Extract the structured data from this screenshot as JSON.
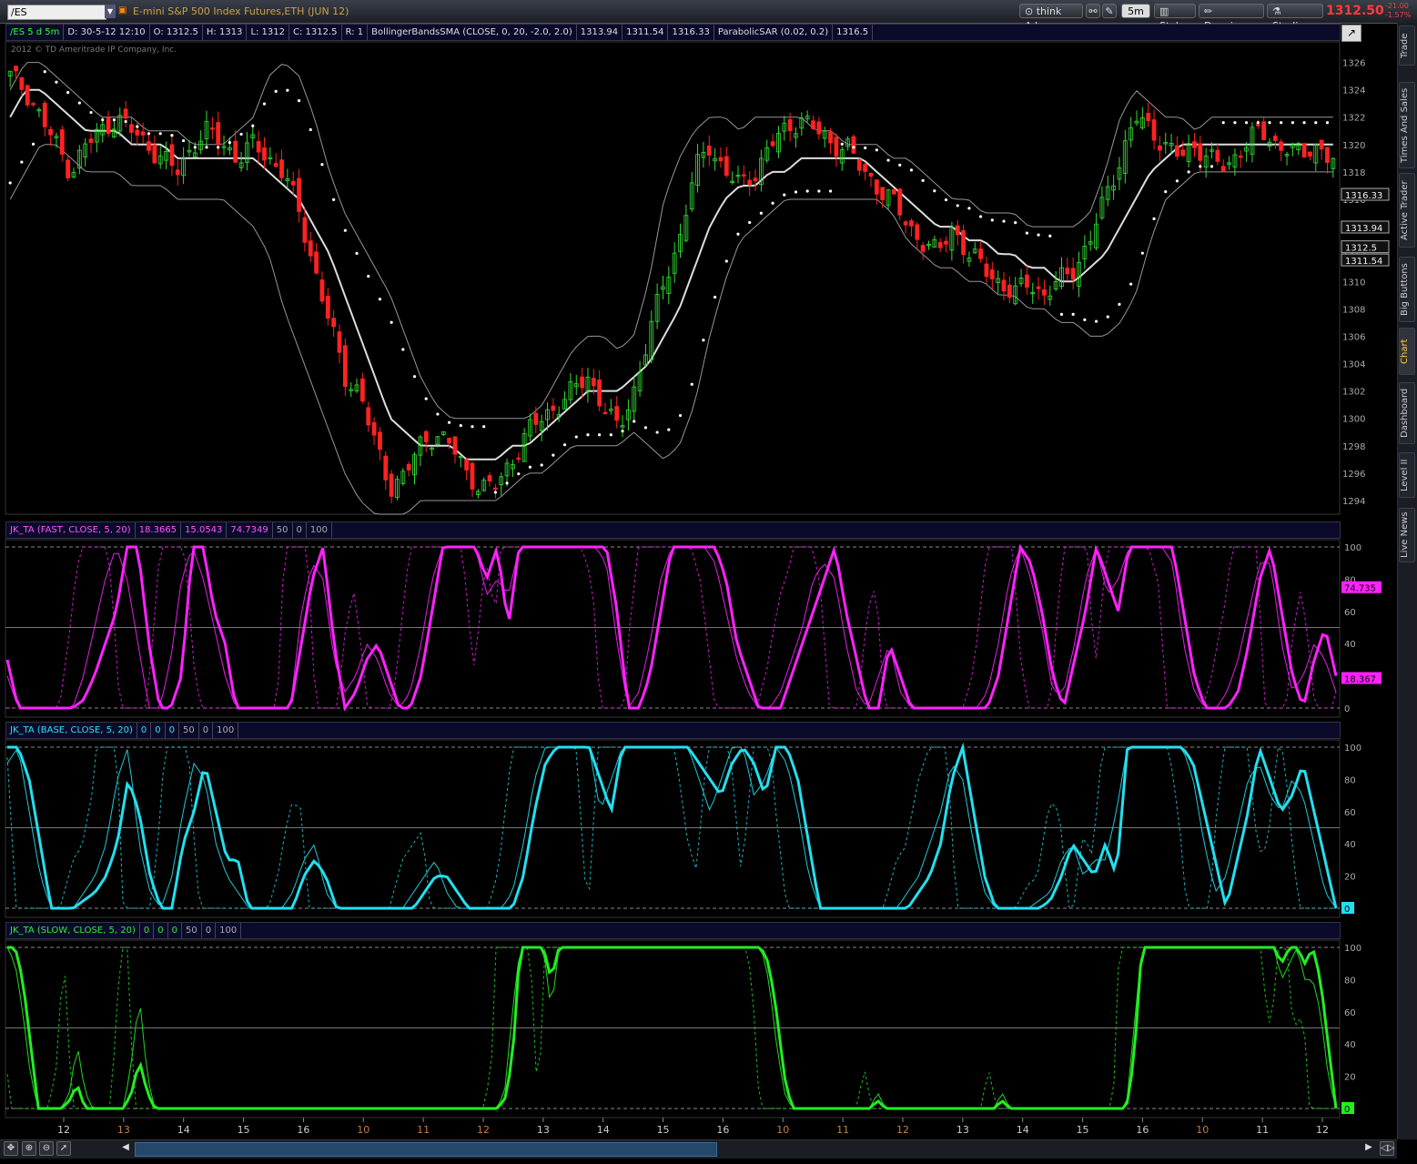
{
  "toolbar": {
    "symbol": "/ES",
    "instrument": "E-mini S&P 500 Index Futures,ETH (JUN 12)",
    "think_ai": "think A.I.",
    "timeframe": "5m",
    "style": "Style",
    "drawings": "Drawings",
    "studies": "Studies",
    "last_price": "1312.50",
    "change_abs": "-21.00",
    "change_pct": "-1.57%"
  },
  "price_header": [
    "/ES 5 d 5m",
    "D: 30-5-12 12:10",
    "O: 1312.5",
    "H: 1313",
    "L: 1312",
    "C: 1312.5",
    "R: 1",
    "BollingerBandsSMA (CLOSE, 0, 20, -2.0, 2.0)",
    "1313.94",
    "1311.54",
    "1316.33",
    "ParabolicSAR (0.02, 0.2)",
    "1316.5"
  ],
  "copyright": "2012 © TD Ameritrade IP Company, Inc.",
  "fast_header": [
    "JK_TA (FAST, CLOSE, 5, 20)",
    "18.3665",
    "15.0543",
    "74.7349",
    "50",
    "0",
    "100"
  ],
  "base_header": [
    "JK_TA (BASE, CLOSE, 5, 20)",
    "0",
    "0",
    "0",
    "50",
    "0",
    "100"
  ],
  "slow_header": [
    "JK_TA (SLOW, CLOSE, 5, 20)",
    "0",
    "0",
    "0",
    "50",
    "0",
    "100"
  ],
  "side_tabs": [
    "Trade",
    "Times And Sales",
    "Active Trader",
    "Big Buttons",
    "Chart",
    "Dashboard",
    "Level II",
    "Live News"
  ],
  "colors": {
    "up": "#33dd33",
    "down": "#ff2222",
    "fast": "#ff22ff",
    "base": "#22e0f0",
    "slow": "#22ee22",
    "bands": "#bbbbbb",
    "sar": "#ffffff"
  },
  "chart_data": [
    {
      "type": "candlestick",
      "title": "/ES 5 d 5m",
      "y_axis_ticks": [
        1294,
        1296,
        1298,
        1300,
        1302,
        1304,
        1306,
        1308,
        1310,
        1312,
        1314,
        1316,
        1318,
        1320,
        1322,
        1324,
        1326
      ],
      "ylim": [
        1293,
        1327.5
      ],
      "price_labels": [
        {
          "label": "1316.33",
          "value": 1316.33
        },
        {
          "label": "1313.94",
          "value": 1313.94
        },
        {
          "label": "1312.5",
          "value": 1312.5
        },
        {
          "label": "1311.54",
          "value": 1311.54
        }
      ],
      "close_series": [
        1325,
        1324,
        1322,
        1320,
        1318,
        1320,
        1321,
        1322,
        1321,
        1320,
        1319,
        1318,
        1320,
        1321,
        1320,
        1319,
        1320,
        1319,
        1318,
        1315,
        1311,
        1307,
        1303,
        1302,
        1298,
        1295,
        1296,
        1298,
        1299,
        1298,
        1296,
        1295,
        1295,
        1297,
        1299,
        1300,
        1301,
        1302,
        1303,
        1301,
        1299,
        1302,
        1306,
        1310,
        1313,
        1318,
        1320,
        1318,
        1317,
        1318,
        1320,
        1321,
        1322,
        1321,
        1320,
        1320,
        1318,
        1317,
        1316,
        1314,
        1313,
        1312,
        1314,
        1312,
        1311,
        1310,
        1309,
        1310,
        1309,
        1310,
        1311,
        1313,
        1316,
        1319,
        1322,
        1321,
        1320,
        1319,
        1320,
        1319,
        1318,
        1320,
        1321,
        1320,
        1320,
        1319,
        1320,
        1319
      ],
      "bollinger_middle_series": [
        1322,
        1324,
        1324,
        1323,
        1322,
        1321,
        1321,
        1321,
        1320,
        1320,
        1320,
        1319,
        1319,
        1319,
        1319,
        1319,
        1319,
        1318,
        1317,
        1316,
        1314,
        1312,
        1309,
        1306,
        1303,
        1300,
        1299,
        1298,
        1298,
        1298,
        1297,
        1297,
        1297,
        1298,
        1298,
        1299,
        1300,
        1301,
        1302,
        1302,
        1302,
        1303,
        1304,
        1306,
        1308,
        1311,
        1314,
        1316,
        1317,
        1317,
        1318,
        1318,
        1319,
        1319,
        1319,
        1319,
        1319,
        1318,
        1317,
        1316,
        1315,
        1314,
        1314,
        1313,
        1313,
        1312,
        1312,
        1311,
        1311,
        1310,
        1310,
        1311,
        1312,
        1314,
        1316,
        1318,
        1319,
        1320,
        1320,
        1320,
        1320,
        1320,
        1320,
        1320,
        1320,
        1320,
        1320,
        1320
      ],
      "bollinger_upper_series": [
        1324,
        1326,
        1326,
        1325,
        1324,
        1323,
        1322,
        1322,
        1322,
        1321,
        1321,
        1321,
        1320,
        1320,
        1320,
        1321,
        1322,
        1325,
        1326,
        1325,
        1322,
        1318,
        1315,
        1313,
        1311,
        1309,
        1306,
        1303,
        1301,
        1300,
        1300,
        1300,
        1300,
        1300,
        1300,
        1301,
        1303,
        1305,
        1306,
        1306,
        1305,
        1306,
        1310,
        1316,
        1319,
        1321,
        1322,
        1322,
        1321,
        1322,
        1322,
        1322,
        1322,
        1321,
        1321,
        1320,
        1320,
        1320,
        1319,
        1319,
        1318,
        1317,
        1316,
        1316,
        1315,
        1315,
        1315,
        1314,
        1314,
        1314,
        1314,
        1315,
        1318,
        1322,
        1324,
        1323,
        1322,
        1322,
        1321,
        1322,
        1322,
        1322,
        1322,
        1322,
        1322,
        1322,
        1322,
        1322
      ],
      "bollinger_lower_series": [
        1316,
        1318,
        1320,
        1320,
        1319,
        1318,
        1318,
        1318,
        1317,
        1317,
        1317,
        1316,
        1316,
        1316,
        1316,
        1315,
        1314,
        1312,
        1308,
        1305,
        1302,
        1299,
        1296,
        1294,
        1293,
        1293,
        1293,
        1294,
        1294,
        1294,
        1294,
        1294,
        1294,
        1295,
        1296,
        1296,
        1297,
        1298,
        1298,
        1298,
        1298,
        1299,
        1298,
        1297,
        1298,
        1301,
        1306,
        1310,
        1313,
        1314,
        1315,
        1316,
        1316,
        1316,
        1316,
        1316,
        1316,
        1316,
        1315,
        1313,
        1312,
        1311,
        1311,
        1310,
        1310,
        1309,
        1309,
        1308,
        1308,
        1307,
        1307,
        1306,
        1306,
        1307,
        1309,
        1313,
        1316,
        1317,
        1318,
        1318,
        1318,
        1318,
        1318,
        1318,
        1318,
        1318,
        1318,
        1318
      ]
    },
    {
      "type": "line",
      "title": "JK_TA (FAST, CLOSE, 5, 20)",
      "y_axis_ticks": [
        0,
        20,
        40,
        60,
        80,
        100
      ],
      "ylim": [
        0,
        100
      ],
      "current_labels": [
        {
          "label": "74.735",
          "value": 74.735
        },
        {
          "label": "18.367",
          "value": 18.367
        }
      ],
      "thick_series": [
        30,
        0,
        0,
        0,
        0,
        0,
        0,
        5,
        20,
        40,
        60,
        100,
        100,
        40,
        0,
        0,
        20,
        100,
        100,
        60,
        40,
        0,
        0,
        0,
        0,
        0,
        0,
        40,
        80,
        100,
        40,
        0,
        10,
        30,
        40,
        20,
        0,
        0,
        20,
        60,
        100,
        100,
        100,
        100,
        80,
        100,
        50,
        100,
        100,
        100,
        100,
        100,
        100,
        100,
        100,
        100,
        60,
        0,
        0,
        20,
        60,
        100,
        100,
        100,
        100,
        100,
        80,
        40,
        20,
        0,
        0,
        0,
        20,
        40,
        60,
        80,
        100,
        60,
        30,
        0,
        0,
        40,
        20,
        0,
        0,
        0,
        0,
        0,
        0,
        0,
        0,
        20,
        60,
        100,
        90,
        60,
        20,
        0,
        30,
        60,
        100,
        80,
        60,
        100,
        100,
        100,
        100,
        100,
        60,
        20,
        0,
        0,
        0,
        10,
        40,
        80,
        100,
        60,
        20,
        0,
        30,
        50,
        20
      ],
      "thin_series": [
        20,
        0,
        0,
        0,
        0,
        0,
        0,
        20,
        50,
        80,
        100,
        80,
        40,
        0,
        0,
        30,
        80,
        100,
        80,
        50,
        20,
        0,
        0,
        0,
        0,
        0,
        0,
        60,
        90,
        80,
        30,
        10,
        20,
        40,
        30,
        10,
        0,
        10,
        40,
        80,
        100,
        100,
        100,
        100,
        70,
        80,
        70,
        100,
        100,
        100,
        100,
        100,
        100,
        100,
        100,
        90,
        40,
        0,
        10,
        40,
        80,
        100,
        100,
        100,
        100,
        90,
        60,
        30,
        10,
        0,
        0,
        10,
        30,
        50,
        80,
        90,
        80,
        40,
        10,
        0,
        20,
        40,
        10,
        0,
        0,
        0,
        0,
        0,
        0,
        0,
        10,
        40,
        80,
        100,
        80,
        50,
        10,
        10,
        40,
        80,
        100,
        70,
        80,
        100,
        100,
        100,
        100,
        90,
        40,
        10,
        0,
        0,
        10,
        30,
        60,
        90,
        90,
        40,
        10,
        20,
        40,
        30,
        10
      ]
    },
    {
      "type": "line",
      "title": "JK_TA (BASE, CLOSE, 5, 20)",
      "y_axis_ticks": [
        0,
        20,
        40,
        60,
        80,
        100
      ],
      "ylim": [
        0,
        100
      ],
      "current_labels": [
        {
          "label": "0",
          "value": 0
        }
      ],
      "thick_series": [
        100,
        100,
        80,
        40,
        0,
        0,
        0,
        5,
        10,
        20,
        40,
        80,
        60,
        20,
        0,
        0,
        40,
        60,
        90,
        60,
        30,
        30,
        0,
        0,
        0,
        0,
        0,
        20,
        30,
        20,
        0,
        0,
        0,
        0,
        0,
        0,
        0,
        0,
        10,
        20,
        20,
        10,
        0,
        0,
        0,
        0,
        0,
        20,
        60,
        90,
        100,
        100,
        100,
        100,
        80,
        60,
        100,
        100,
        100,
        100,
        100,
        100,
        100,
        90,
        80,
        70,
        90,
        100,
        90,
        70,
        100,
        100,
        80,
        40,
        0,
        0,
        0,
        0,
        0,
        0,
        0,
        0,
        0,
        10,
        20,
        40,
        80,
        100,
        60,
        20,
        0,
        0,
        0,
        0,
        0,
        5,
        20,
        40,
        30,
        20,
        40,
        20,
        100,
        100,
        100,
        100,
        100,
        100,
        90,
        60,
        30,
        0,
        30,
        60,
        100,
        80,
        60,
        70,
        90,
        60,
        30,
        0
      ],
      "thin_series": [
        90,
        100,
        60,
        20,
        0,
        0,
        0,
        10,
        20,
        40,
        80,
        100,
        40,
        10,
        0,
        20,
        60,
        90,
        80,
        40,
        20,
        10,
        0,
        0,
        0,
        0,
        10,
        30,
        40,
        10,
        0,
        0,
        0,
        0,
        0,
        0,
        0,
        10,
        20,
        30,
        10,
        0,
        0,
        0,
        0,
        0,
        10,
        40,
        80,
        100,
        100,
        100,
        100,
        100,
        60,
        80,
        100,
        100,
        100,
        100,
        100,
        100,
        100,
        80,
        60,
        80,
        100,
        100,
        70,
        80,
        100,
        90,
        60,
        20,
        0,
        0,
        0,
        0,
        0,
        0,
        0,
        0,
        10,
        20,
        40,
        60,
        90,
        80,
        40,
        10,
        0,
        0,
        0,
        0,
        5,
        10,
        30,
        40,
        20,
        30,
        30,
        60,
        100,
        100,
        100,
        100,
        100,
        100,
        80,
        40,
        10,
        20,
        50,
        80,
        90,
        70,
        60,
        80,
        70,
        40,
        10,
        0
      ]
    },
    {
      "type": "line",
      "title": "JK_TA (SLOW, CLOSE, 5, 20)",
      "y_axis_ticks": [
        0,
        20,
        40,
        60,
        80,
        100
      ],
      "ylim": [
        0,
        100
      ],
      "current_labels": [
        {
          "label": "0",
          "value": 0
        }
      ],
      "thick_series": [
        100,
        100,
        80,
        40,
        0,
        0,
        0,
        0,
        5,
        15,
        0,
        0,
        0,
        0,
        0,
        0,
        10,
        30,
        10,
        0,
        0,
        0,
        0,
        0,
        0,
        0,
        0,
        0,
        0,
        0,
        0,
        0,
        0,
        0,
        0,
        0,
        0,
        0,
        0,
        0,
        0,
        0,
        0,
        0,
        0,
        0,
        0,
        0,
        0,
        0,
        0,
        0,
        0,
        0,
        0,
        0,
        0,
        0,
        0,
        0,
        0,
        0,
        0,
        0,
        5,
        30,
        100,
        100,
        100,
        100,
        80,
        100,
        100,
        100,
        100,
        100,
        100,
        100,
        100,
        100,
        100,
        100,
        100,
        100,
        100,
        100,
        100,
        100,
        100,
        100,
        100,
        100,
        100,
        100,
        100,
        100,
        100,
        100,
        90,
        60,
        20,
        0,
        0,
        0,
        0,
        0,
        0,
        0,
        0,
        0,
        0,
        0,
        5,
        0,
        0,
        0,
        0,
        0,
        0,
        0,
        0,
        0,
        0,
        0,
        0,
        0,
        0,
        0,
        5,
        0,
        0,
        0,
        0,
        0,
        0,
        0,
        0,
        0,
        0,
        0,
        0,
        0,
        0,
        0,
        0,
        30,
        100,
        100,
        100,
        100,
        100,
        100,
        100,
        100,
        100,
        100,
        100,
        100,
        100,
        100,
        100,
        100,
        100,
        100,
        90,
        100,
        100,
        90,
        100,
        80,
        40,
        0
      ],
      "thin_series": [
        100,
        90,
        60,
        20,
        0,
        0,
        0,
        0,
        10,
        40,
        10,
        0,
        0,
        0,
        0,
        0,
        30,
        70,
        20,
        0,
        0,
        0,
        0,
        0,
        0,
        0,
        0,
        0,
        0,
        0,
        0,
        0,
        0,
        0,
        0,
        0,
        0,
        0,
        0,
        0,
        0,
        0,
        0,
        0,
        0,
        0,
        0,
        0,
        0,
        0,
        0,
        0,
        0,
        0,
        0,
        0,
        0,
        0,
        0,
        0,
        0,
        0,
        0,
        0,
        10,
        60,
        100,
        100,
        100,
        100,
        60,
        100,
        100,
        100,
        100,
        100,
        100,
        100,
        100,
        100,
        100,
        100,
        100,
        100,
        100,
        100,
        100,
        100,
        100,
        100,
        100,
        100,
        100,
        100,
        100,
        100,
        100,
        100,
        80,
        40,
        10,
        0,
        0,
        0,
        0,
        0,
        0,
        0,
        0,
        0,
        0,
        0,
        10,
        0,
        0,
        0,
        0,
        0,
        0,
        0,
        0,
        0,
        0,
        0,
        0,
        0,
        0,
        0,
        10,
        0,
        0,
        0,
        0,
        0,
        0,
        0,
        0,
        0,
        0,
        0,
        0,
        0,
        0,
        0,
        0,
        50,
        100,
        100,
        100,
        100,
        100,
        100,
        100,
        100,
        100,
        100,
        100,
        100,
        100,
        100,
        100,
        100,
        100,
        100,
        80,
        90,
        100,
        80,
        80,
        60,
        20,
        0
      ]
    }
  ],
  "x_axis_labels": [
    "12",
    "13",
    "14",
    "15",
    "16",
    "10",
    "11",
    "12",
    "13",
    "14",
    "15",
    "16",
    "10",
    "11",
    "12",
    "13",
    "14",
    "15",
    "16",
    "10",
    "11",
    "12"
  ],
  "x_axis_label_days": [
    "day",
    "night",
    "day",
    "day",
    "day",
    "night",
    "night",
    "night",
    "day",
    "day",
    "day",
    "day",
    "night",
    "night",
    "night",
    "day",
    "day",
    "day",
    "day",
    "night",
    "day",
    "day"
  ]
}
